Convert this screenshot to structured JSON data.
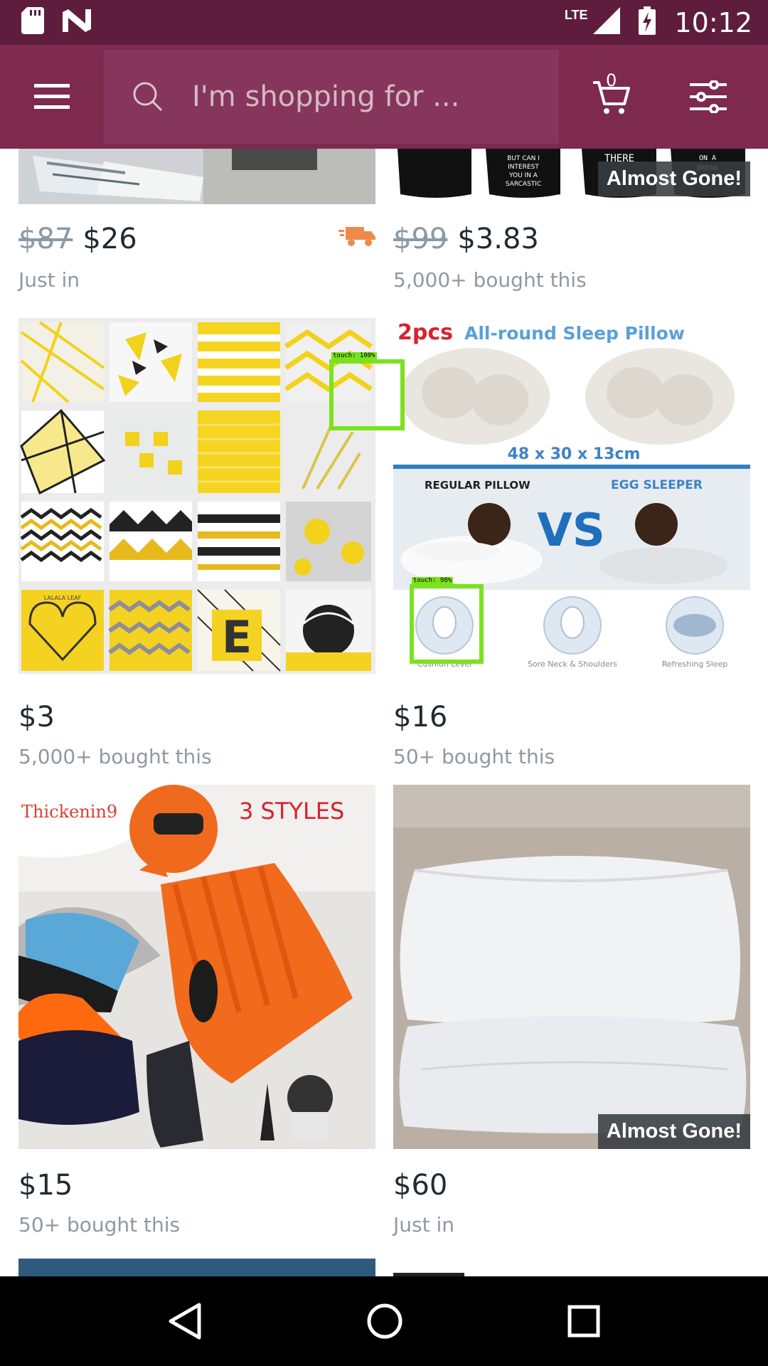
{
  "status_bar": {
    "time": "10:12",
    "network": "LTE",
    "icons": [
      "sd-card-icon",
      "n-notification-icon",
      "signal-icon",
      "battery-charging-icon"
    ]
  },
  "app_bar": {
    "search_placeholder": "I'm shopping for ...",
    "cart_count": "0"
  },
  "products": [
    {
      "old_price": "$87",
      "price": "$26",
      "meta": "Just in",
      "badge": "",
      "shipping_icon": "truck-icon"
    },
    {
      "old_price": "$99",
      "price": "$3.83",
      "meta": "5,000+ bought this",
      "badge": "Almost Gone!",
      "image_text": [
        "BUT CAN I INTEREST YOU IN A SARCASTIC COMMENT?",
        "THERE",
        "ON A BREAK"
      ]
    },
    {
      "old_price": "",
      "price": "$3",
      "meta": "5,000+ bought this",
      "badge": "",
      "image_text": [
        "LALALA LEAF",
        "E"
      ]
    },
    {
      "old_price": "",
      "price": "$16",
      "meta": "50+ bought this",
      "badge": "",
      "image_text": {
        "count": "2pcs",
        "title": "All-round Sleep Pillow",
        "size": "48 x 30 x 13cm",
        "left_label": "REGULAR PILLOW",
        "right_label": "EGG SLEEPER",
        "vs": "VS",
        "captions": [
          "Cushion Level",
          "Sore Neck & Shoulders",
          "Refreshing Sleep"
        ]
      }
    },
    {
      "old_price": "",
      "price": "$15",
      "meta": "50+ bought this",
      "badge": "",
      "image_text": {
        "left": "Thickenin9",
        "right": "3 STYLES"
      }
    },
    {
      "old_price": "",
      "price": "$60",
      "meta": "Just in",
      "badge": "Almost Gone!"
    }
  ],
  "touch_overlays": [
    "touch: 100%",
    "touch: 98%"
  ],
  "colors": {
    "status_bar": "#5e1d3c",
    "app_bar": "#7e2a4f",
    "search_field": "#86365a",
    "price_text": "#1f2b33",
    "meta_text": "#8f99a2",
    "touch_box": "#7be21f"
  },
  "nav_bar": {
    "icons": [
      "back-icon",
      "home-icon",
      "recents-icon"
    ]
  }
}
